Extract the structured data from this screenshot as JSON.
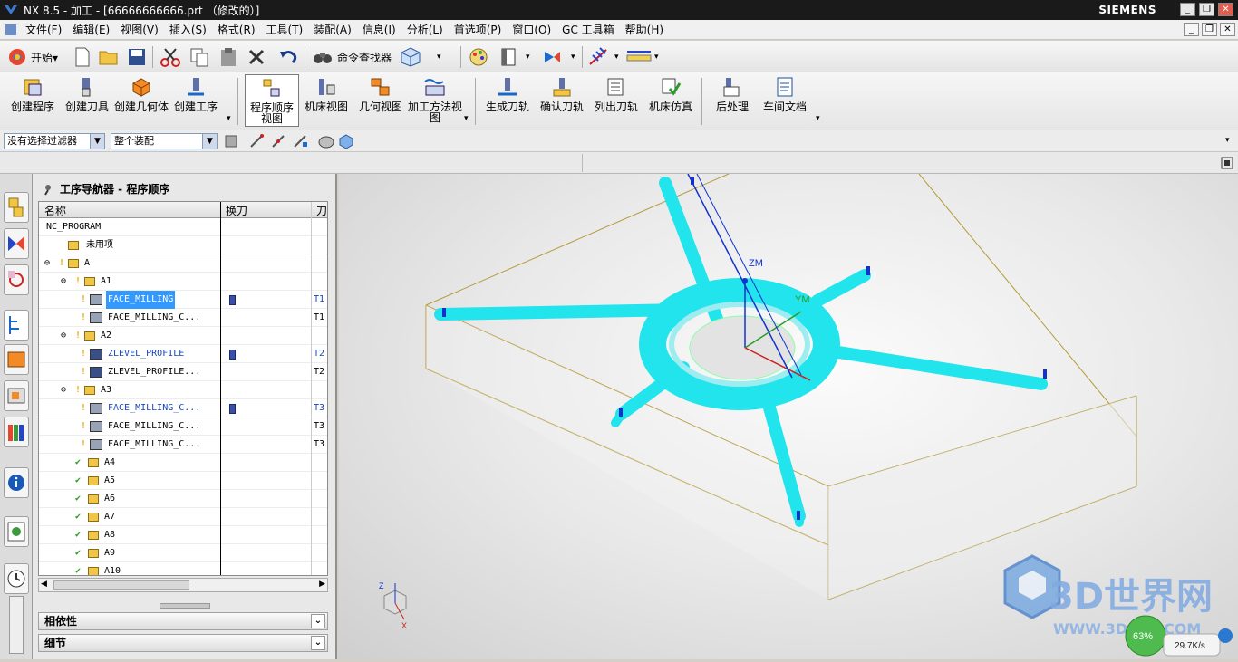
{
  "window": {
    "title": "NX 8.5 - 加工 - [66666666666.prt （修改的）]",
    "brand": "SIEMENS"
  },
  "menubar": [
    "文件(F)",
    "编辑(E)",
    "视图(V)",
    "插入(S)",
    "格式(R)",
    "工具(T)",
    "装配(A)",
    "信息(I)",
    "分析(L)",
    "首选项(P)",
    "窗口(O)",
    "GC 工具箱",
    "帮助(H)"
  ],
  "toolbar1": {
    "start_label": "开始▾",
    "command_finder_label": "命令查找器"
  },
  "toolbar2": {
    "buttons": [
      {
        "label": "创建程序"
      },
      {
        "label": "创建刀具"
      },
      {
        "label": "创建几何体"
      },
      {
        "label": "创建工序"
      },
      {
        "label": "程序顺序视图"
      },
      {
        "label": "机床视图"
      },
      {
        "label": "几何视图"
      },
      {
        "label": "加工方法视图"
      },
      {
        "label": "生成刀轨"
      },
      {
        "label": "确认刀轨"
      },
      {
        "label": "列出刀轨"
      },
      {
        "label": "机床仿真"
      },
      {
        "label": "后处理"
      },
      {
        "label": "车间文档"
      }
    ]
  },
  "filterbar": {
    "selection_filter": "没有选择过滤器",
    "assembly_scope": "整个装配"
  },
  "navigator": {
    "title": "工序导航器 - 程序顺序",
    "columns": [
      "名称",
      "换刀",
      "刀"
    ],
    "rows": [
      {
        "name": "NC_PROGRAM",
        "tool_change": "",
        "tool": ""
      },
      {
        "name": "未用项",
        "tool_change": "",
        "tool": ""
      },
      {
        "name": "A",
        "tool_change": "",
        "tool": ""
      },
      {
        "name": "A1",
        "tool_change": "",
        "tool": ""
      },
      {
        "name": "FACE_MILLING",
        "tool_change": "",
        "tool": "T1"
      },
      {
        "name": "FACE_MILLING_C...",
        "tool_change": "",
        "tool": "T1"
      },
      {
        "name": "A2",
        "tool_change": "",
        "tool": ""
      },
      {
        "name": "ZLEVEL_PROFILE",
        "tool_change": "",
        "tool": "T2"
      },
      {
        "name": "ZLEVEL_PROFILE...",
        "tool_change": "",
        "tool": "T2"
      },
      {
        "name": "A3",
        "tool_change": "",
        "tool": ""
      },
      {
        "name": "FACE_MILLING_C...",
        "tool_change": "",
        "tool": "T3"
      },
      {
        "name": "FACE_MILLING_C...",
        "tool_change": "",
        "tool": "T3"
      },
      {
        "name": "FACE_MILLING_C...",
        "tool_change": "",
        "tool": "T3"
      },
      {
        "name": "A4",
        "tool_change": "",
        "tool": ""
      },
      {
        "name": "A5",
        "tool_change": "",
        "tool": ""
      },
      {
        "name": "A6",
        "tool_change": "",
        "tool": ""
      },
      {
        "name": "A7",
        "tool_change": "",
        "tool": ""
      },
      {
        "name": "A8",
        "tool_change": "",
        "tool": ""
      },
      {
        "name": "A9",
        "tool_change": "",
        "tool": ""
      },
      {
        "name": "A10",
        "tool_change": "",
        "tool": ""
      }
    ],
    "sections": [
      "相依性",
      "细节"
    ]
  },
  "viewport": {
    "labels": {
      "zm": "ZM",
      "ym": "YM",
      "triad_z": "Z",
      "triad_x": "X"
    },
    "watermark": {
      "logo": "3D世界网",
      "url": "WWW.3DSJW.COM"
    },
    "speed": "29.7K/s",
    "percent": "63%"
  },
  "colors": {
    "toolpath": "#22e4ec",
    "wcs_blue": "#1133cc",
    "wire_gold": "#b49b3c",
    "selection": "#3399ff"
  }
}
